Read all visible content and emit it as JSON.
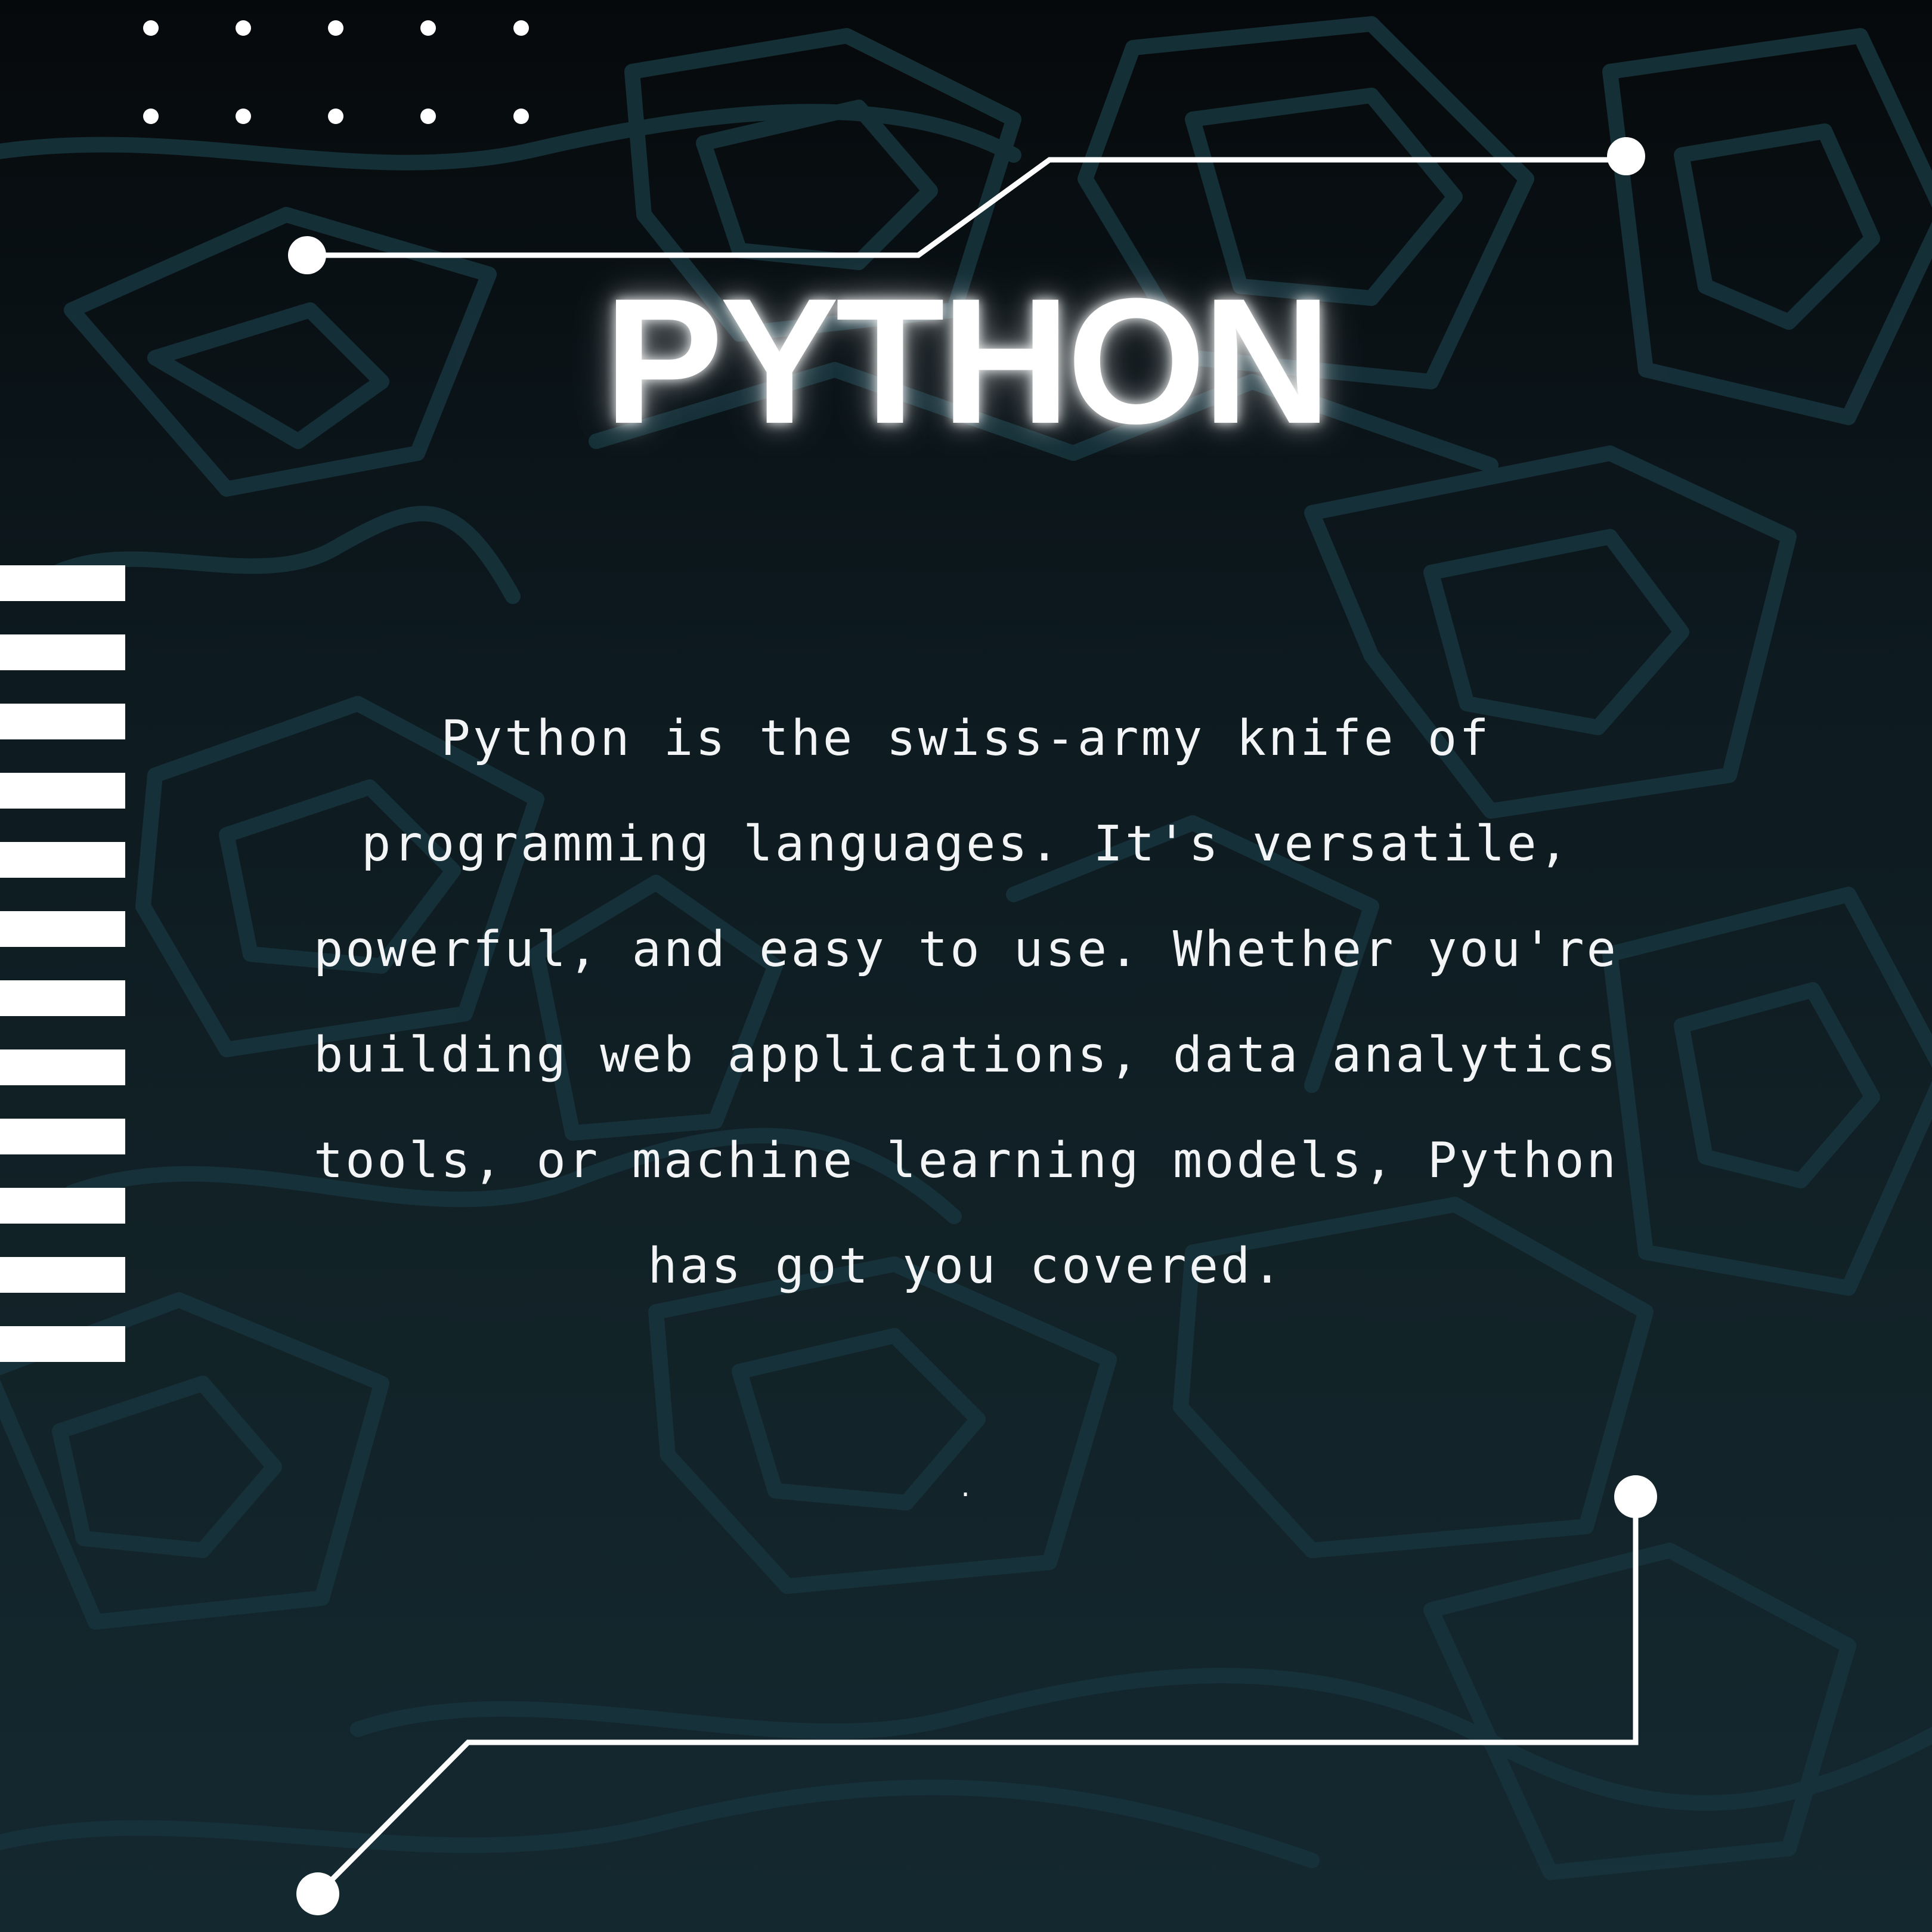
{
  "title": "PYTHON",
  "paragraph": "Python is the swiss-army knife of programming languages. It's versatile, powerful, and easy to use. Whether you're building web applications, data analytics tools, or machine learning models, Python has got you covered.",
  "stray_mark": ".",
  "colors": {
    "background_top": "#06090b",
    "background_bottom": "#142830",
    "pattern_stroke": "#183a44",
    "foreground": "#ffffff"
  }
}
